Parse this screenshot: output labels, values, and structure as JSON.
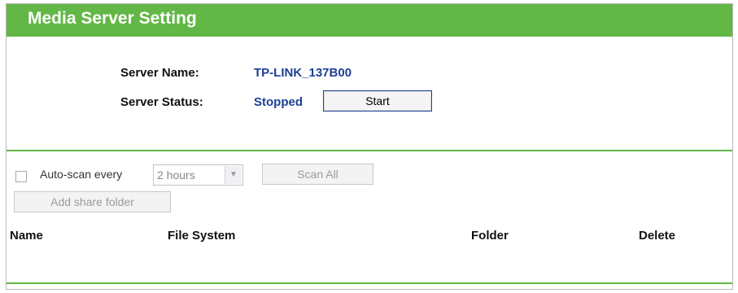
{
  "header": {
    "title": "Media Server Setting"
  },
  "server": {
    "name_label": "Server Name:",
    "name_value": "TP-LINK_137B00",
    "status_label": "Server Status:",
    "status_value": "Stopped",
    "start_button": "Start"
  },
  "autoscan": {
    "checked": false,
    "label": "Auto-scan every",
    "interval_selected": "2 hours",
    "scan_all_button": "Scan All"
  },
  "add_share_folder_button": "Add share folder",
  "table": {
    "columns": [
      "Name",
      "File System",
      "Folder",
      "Delete"
    ]
  },
  "colors": {
    "header_bg": "#62b746",
    "value_text": "#1d3f96"
  }
}
